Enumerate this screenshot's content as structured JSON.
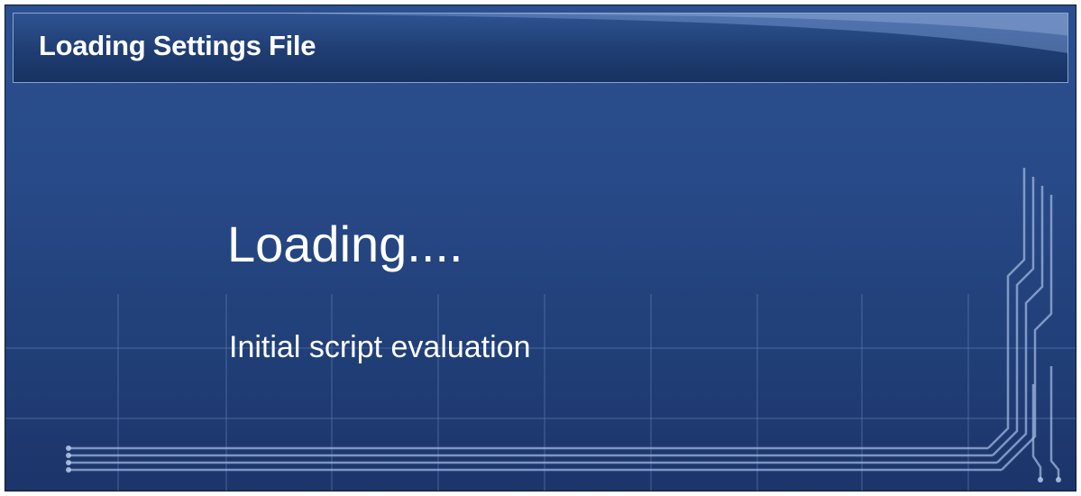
{
  "window": {
    "title": "Loading Settings File"
  },
  "main": {
    "heading": "Loading....",
    "status": "Initial script evaluation"
  },
  "colors": {
    "background": "#284a88",
    "titlebar": "#1f3d72",
    "text": "#ffffff"
  }
}
